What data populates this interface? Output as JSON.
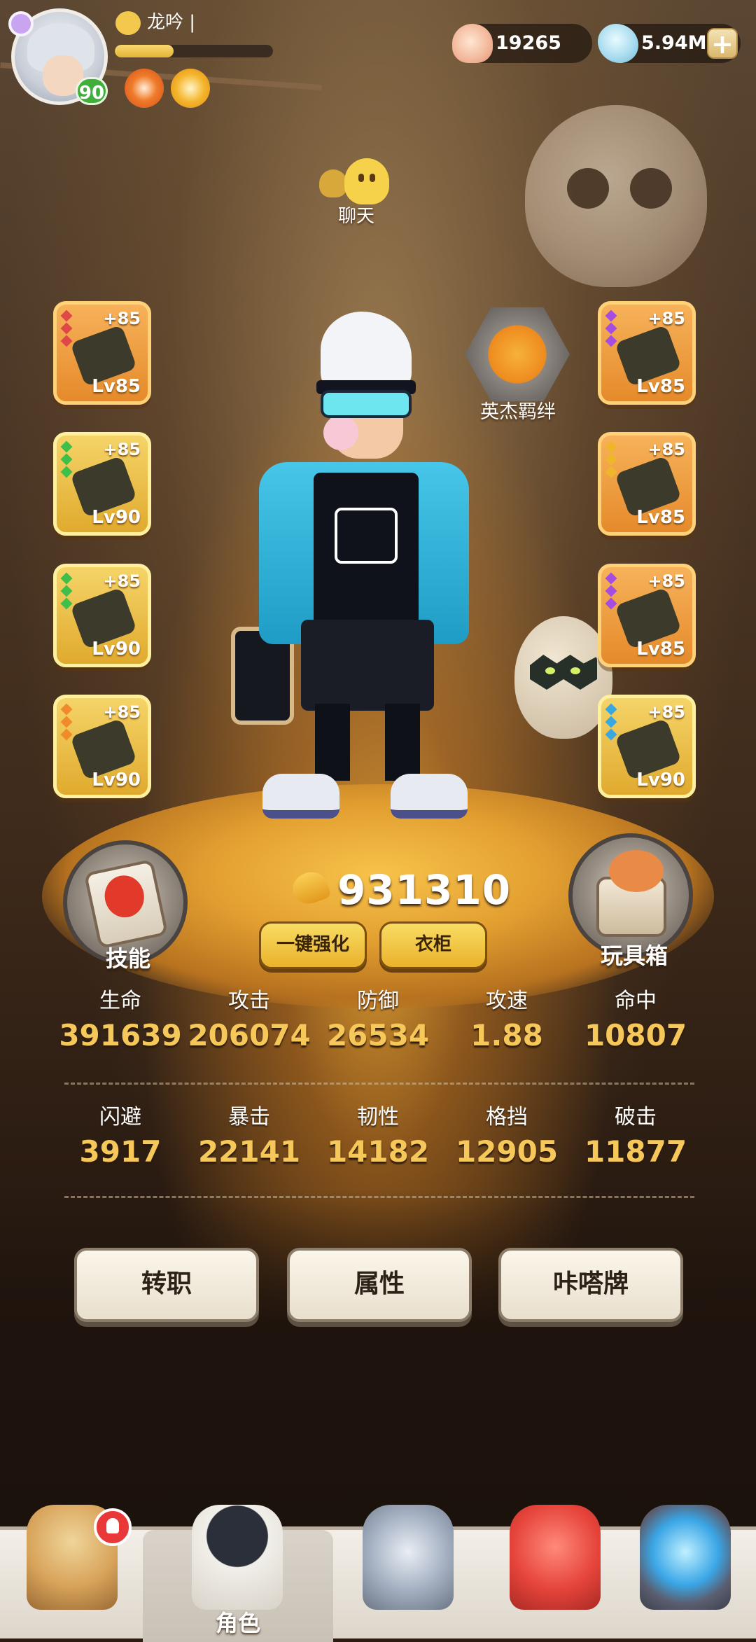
{
  "player": {
    "name": "龙吟 |",
    "level": "90",
    "exp_fraction": 0.37
  },
  "currency": {
    "shells": "19265",
    "gems": "5.94M",
    "plus": "+"
  },
  "chat": {
    "label": "聊天"
  },
  "hero_bond": {
    "label": "英杰羁绊"
  },
  "equipment": {
    "left": [
      {
        "plus": "+85",
        "level": "Lv85",
        "frame": "orange",
        "gem_color": "#e04848"
      },
      {
        "plus": "+85",
        "level": "Lv90",
        "frame": "gold",
        "gem_color": "#3fbf4a"
      },
      {
        "plus": "+85",
        "level": "Lv90",
        "frame": "gold",
        "gem_color": "#3fbf4a"
      },
      {
        "plus": "+85",
        "level": "Lv90",
        "frame": "gold",
        "gem_color": "#f08a2a"
      }
    ],
    "right": [
      {
        "plus": "+85",
        "level": "Lv85",
        "frame": "orange",
        "gem_color": "#a54de0"
      },
      {
        "plus": "+85",
        "level": "Lv85",
        "frame": "orange",
        "gem_color": "#f0b62a"
      },
      {
        "plus": "+85",
        "level": "Lv85",
        "frame": "orange",
        "gem_color": "#a54de0"
      },
      {
        "plus": "+85",
        "level": "Lv90",
        "frame": "gold",
        "gem_color": "#3aa8e0"
      }
    ]
  },
  "skill": {
    "label": "技能"
  },
  "toybox": {
    "label": "玩具箱"
  },
  "power": {
    "value": "931310"
  },
  "buttons": {
    "enhance_all": "一键强化",
    "wardrobe": "衣柜"
  },
  "stats_row1": [
    {
      "label": "生命",
      "value": "391639"
    },
    {
      "label": "攻击",
      "value": "206074"
    },
    {
      "label": "防御",
      "value": "26534"
    },
    {
      "label": "攻速",
      "value": "1.88"
    },
    {
      "label": "命中",
      "value": "10807"
    }
  ],
  "stats_row2": [
    {
      "label": "闪避",
      "value": "3917"
    },
    {
      "label": "暴击",
      "value": "22141"
    },
    {
      "label": "韧性",
      "value": "14182"
    },
    {
      "label": "格挡",
      "value": "12905"
    },
    {
      "label": "破击",
      "value": "11877"
    }
  ],
  "actions": {
    "job_change": "转职",
    "attributes": "属性",
    "card": "咔嗒牌"
  },
  "nav": {
    "active_label": "角色",
    "items": [
      {
        "icon": "viking-helmet-icon"
      },
      {
        "icon": "character-icon",
        "label": "角色"
      },
      {
        "icon": "sword-icon"
      },
      {
        "icon": "red-pet-icon"
      },
      {
        "icon": "portal-icon"
      }
    ]
  }
}
